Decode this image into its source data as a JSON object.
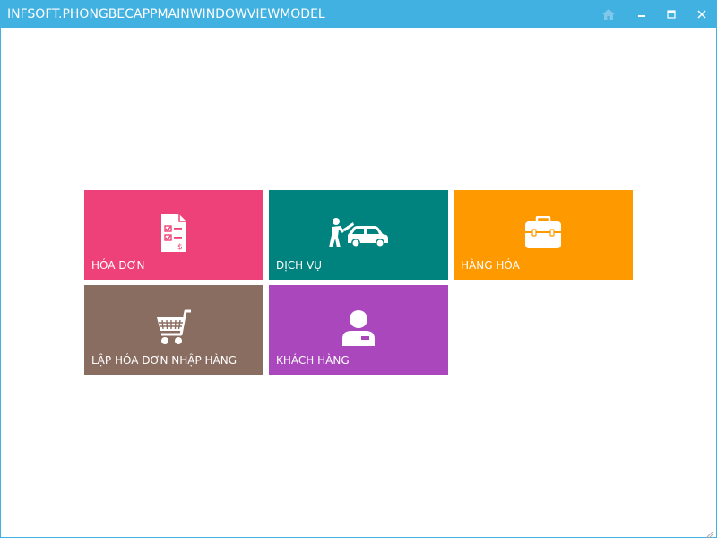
{
  "window": {
    "title": "INFSOFT.PHONGBECAPPMAINWINDOWVIEWMODEL",
    "accent_color": "#41B1E1",
    "buttons": [
      {
        "name": "home",
        "icon": "home-icon"
      },
      {
        "name": "minimize",
        "icon": "minimize-icon"
      },
      {
        "name": "maximize",
        "icon": "maximize-icon"
      },
      {
        "name": "close",
        "icon": "close-icon"
      }
    ]
  },
  "tiles": [
    {
      "label": "HÓA ĐƠN",
      "color": "#EF4179",
      "icon": "invoice-icon"
    },
    {
      "label": "DỊCH VỤ",
      "color": "#00827E",
      "icon": "car-repair-icon"
    },
    {
      "label": "HÀNG HÓA",
      "color": "#FF9900",
      "icon": "toolbox-icon"
    },
    {
      "label": "LẬP HÓA ĐƠN NHẬP HÀNG",
      "color": "#8A6D61",
      "icon": "shopping-cart-icon"
    },
    {
      "label": "KHÁCH HÀNG",
      "color": "#AA47BC",
      "icon": "customer-icon"
    }
  ]
}
